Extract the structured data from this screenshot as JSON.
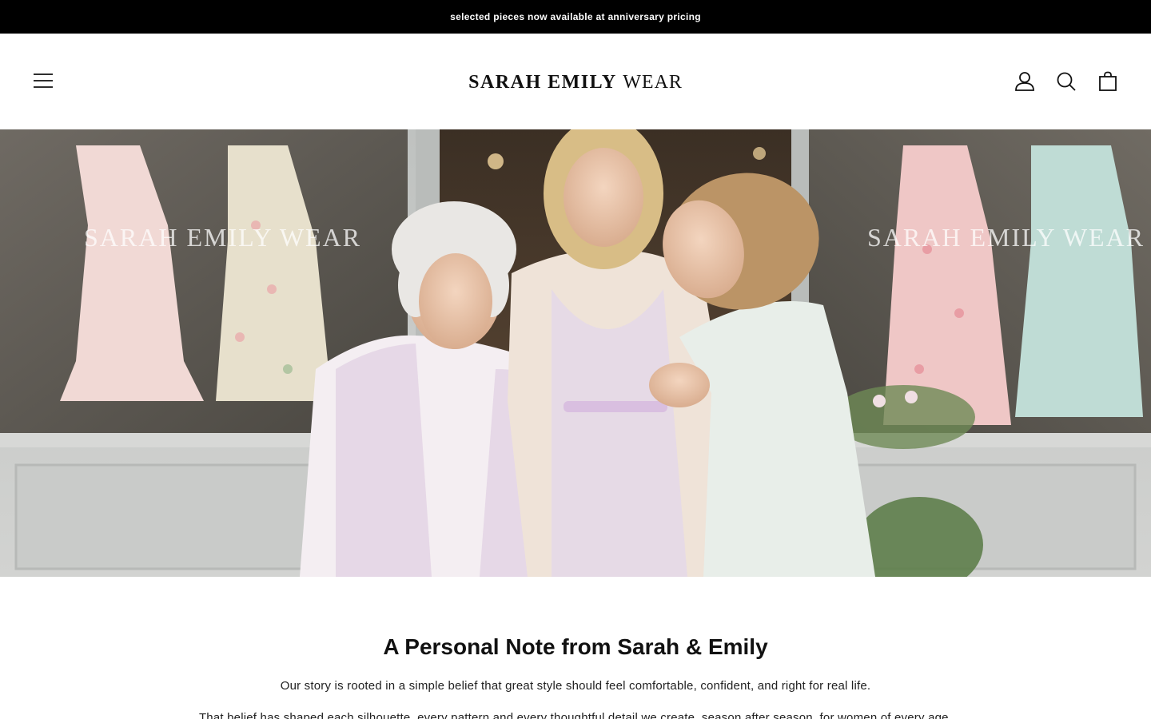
{
  "announcement": {
    "text": "selected pieces now available at anniversary pricing"
  },
  "header": {
    "logo_strong": "SARAH EMILY",
    "logo_light": "WEAR",
    "icons": [
      "menu-icon",
      "account-icon",
      "search-icon",
      "cart-icon"
    ]
  },
  "hero": {
    "window_lettering": "SARAH EMILY WEAR",
    "alt": "Three generations of women standing in front of a Sarah Emily Wear shop window"
  },
  "note": {
    "title": "A Personal Note from Sarah & Emily",
    "paragraph1": "Our story is rooted in a simple belief that great style should feel comfortable, confident, and right for real life.",
    "paragraph2": "That belief has shaped each silhouette, every pattern and every thoughtful detail we create, season after season, for women of every age."
  },
  "colors": {
    "announcement_bg": "#000000",
    "text": "#111111",
    "background": "#ffffff"
  }
}
